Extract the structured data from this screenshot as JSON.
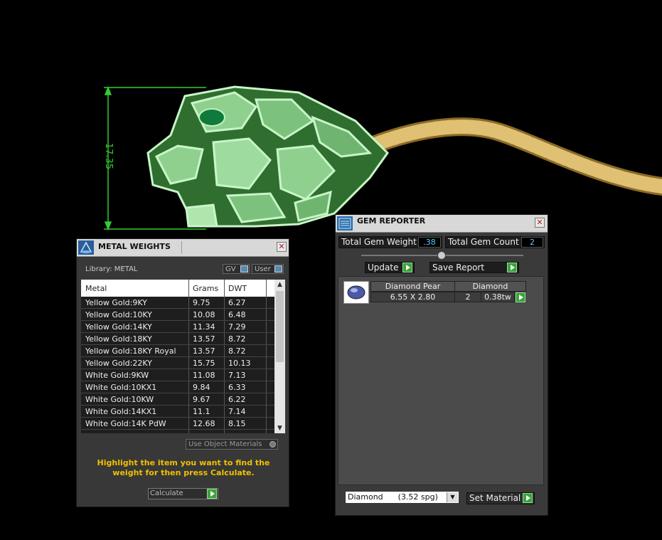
{
  "viewport": {
    "dimension_value": "17.35"
  },
  "metal_panel": {
    "title": "METAL WEIGHTS",
    "library_label": "Library: METAL",
    "gv_label": "GV",
    "user_label": "User",
    "columns": [
      "Metal",
      "Grams",
      "DWT"
    ],
    "rows": [
      {
        "metal": "Yellow Gold:9KY",
        "grams": "9.75",
        "dwt": "6.27"
      },
      {
        "metal": "Yellow Gold:10KY",
        "grams": "10.08",
        "dwt": "6.48"
      },
      {
        "metal": "Yellow Gold:14KY",
        "grams": "11.34",
        "dwt": "7.29"
      },
      {
        "metal": "Yellow Gold:18KY",
        "grams": "13.57",
        "dwt": "8.72"
      },
      {
        "metal": "Yellow Gold:18KY Royal",
        "grams": "13.57",
        "dwt": "8.72"
      },
      {
        "metal": "Yellow Gold:22KY",
        "grams": "15.75",
        "dwt": "10.13"
      },
      {
        "metal": "White Gold:9KW",
        "grams": "11.08",
        "dwt": "7.13"
      },
      {
        "metal": "White Gold:10KX1",
        "grams": "9.84",
        "dwt": "6.33"
      },
      {
        "metal": "White Gold:10KW",
        "grams": "9.67",
        "dwt": "6.22"
      },
      {
        "metal": "White Gold:14KX1",
        "grams": "11.1",
        "dwt": "7.14"
      },
      {
        "metal": "White Gold:14K PdW",
        "grams": "12.68",
        "dwt": "8.15"
      }
    ],
    "use_object_materials": "Use Object Materials",
    "hint": "Highlight the item you want to find the weight for then press Calculate.",
    "calculate_label": "Calculate"
  },
  "gem_panel": {
    "title": "GEM REPORTER",
    "total_weight_label": "Total Gem Weight",
    "total_weight_value": ".38",
    "total_count_label": "Total Gem Count",
    "total_count_value": "2",
    "update_label": "Update",
    "save_report_label": "Save Report",
    "gem": {
      "shape": "Diamond Pear",
      "material": "Diamond",
      "size": "6.55 X 2.80",
      "count": "2",
      "weight": "0.38tw"
    },
    "material_select": "Diamond      (3.52 spg)",
    "set_material_label": "Set Material"
  }
}
